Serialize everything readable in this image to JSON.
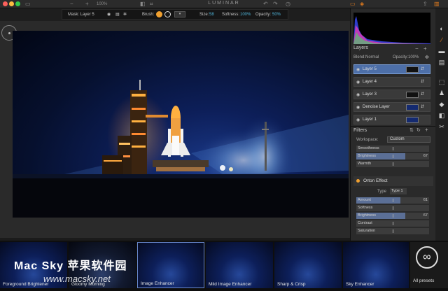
{
  "app": {
    "title": "LUMINAR",
    "zoom": "100%"
  },
  "options_bar": {
    "mask_label": "Mask: Layer 5",
    "brush_label": "Brush:",
    "size_label": "Size:",
    "size_value": "58",
    "softness_label": "Softness:",
    "softness_value": "100%",
    "opacity_label": "Opacity:",
    "opacity_value": "50%"
  },
  "layers": {
    "header": "Layers",
    "blend_label": "Blend:",
    "blend_value": "Normal",
    "opacity_label": "Opacity:",
    "opacity_value": "100%",
    "items": [
      {
        "label": "Layer 5"
      },
      {
        "label": "Layer 4"
      },
      {
        "label": "Layer 3"
      },
      {
        "label": "Denoise Layer"
      },
      {
        "label": "Layer 1"
      }
    ]
  },
  "filters": {
    "header": "Filters",
    "workspace_label": "Workspace:",
    "workspace_value": "Custom",
    "top_sliders": [
      {
        "label": "Smoothness",
        "value": "",
        "level": 0.0
      },
      {
        "label": "Brightness",
        "value": "67",
        "level": 0.67
      },
      {
        "label": "Warmth",
        "value": "",
        "level": 0.0
      }
    ],
    "orton": {
      "title": "Orton Effect",
      "type_label": "Type",
      "type_value": "Type 1",
      "sliders": [
        {
          "label": "Amount",
          "value": "61",
          "level": 0.61
        },
        {
          "label": "Softness",
          "value": "",
          "level": 0.0
        },
        {
          "label": "Brightness",
          "value": "67",
          "level": 0.67
        },
        {
          "label": "Contrast",
          "value": "",
          "level": 0.0
        },
        {
          "label": "Saturation",
          "value": "",
          "level": 0.0
        }
      ]
    }
  },
  "presets": {
    "items": [
      {
        "label": "Foreground Brightener"
      },
      {
        "label": "Gloomy Morning"
      },
      {
        "label": "Image Enhancer"
      },
      {
        "label": "Mild Image Enhancer"
      },
      {
        "label": "Sharp & Crisp"
      },
      {
        "label": "Sky Enhancer"
      }
    ],
    "all_label": "All presets",
    "all_icon": "infinity-icon"
  },
  "watermark": {
    "line1": "Mac Sky 苹果软件园",
    "line2": "www.macsky.net"
  }
}
